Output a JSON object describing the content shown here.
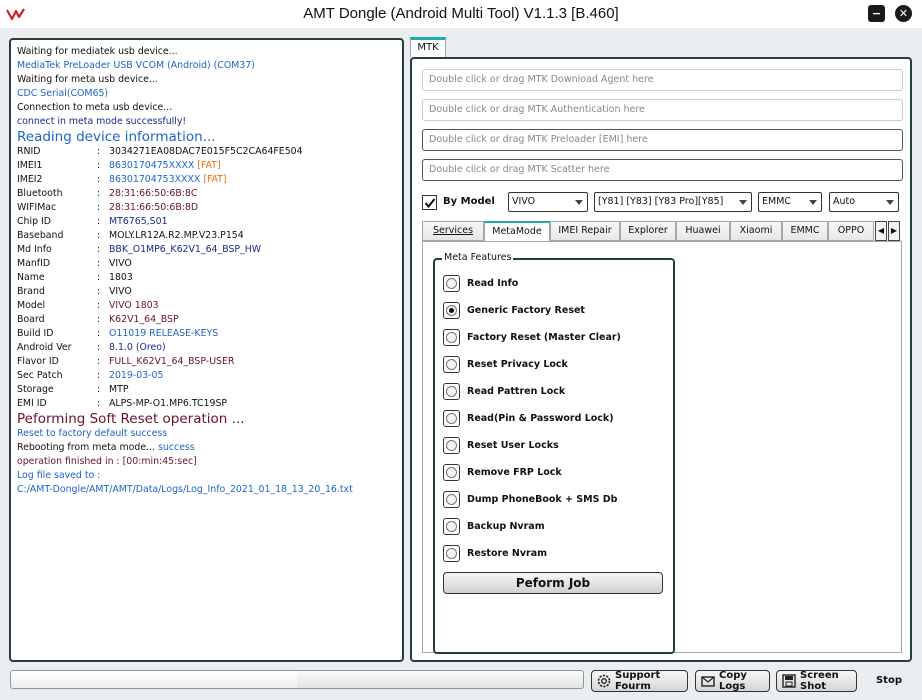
{
  "window": {
    "title": "AMT Dongle (Android Multi Tool) V1.1.3 [B.460]",
    "minimize_label": "−",
    "close_label": "✕"
  },
  "log": {
    "lines": [
      {
        "text": "Waiting for mediatek usb device...",
        "color": "black"
      },
      {
        "text": "MediaTek PreLoader USB VCOM (Android)  (COM37)",
        "color": "blue"
      },
      {
        "text": "Waiting for meta usb device...",
        "color": "black"
      },
      {
        "text": "CDC Serial(COM65)",
        "color": "blue"
      },
      {
        "text": "Connection to meta usb device...",
        "color": "black"
      },
      {
        "text": "connect in meta mode successfully!",
        "color": "navy"
      },
      {
        "text": "Reading device information...",
        "color": "blue"
      }
    ],
    "info": [
      {
        "key": "RNID",
        "sep": ":",
        "value": "3034271EA08DAC7E015F5C2CA64FE504",
        "value_color": "black"
      },
      {
        "key": "IMEI1",
        "sep": ":",
        "value": "8630170475XXXX",
        "value_color": "blue",
        "tag": "[FAT]"
      },
      {
        "key": "IMEI2",
        "sep": ":",
        "value": "86301704753XXXX",
        "value_color": "blue",
        "tag": "[FAT]"
      },
      {
        "key": "Bluetooth",
        "sep": ":",
        "value": "28:31:66:50:6B:8C",
        "value_color": "maroon"
      },
      {
        "key": "WIFIMac",
        "sep": ":",
        "value": "28:31:66:50:6B:8D",
        "value_color": "maroon"
      },
      {
        "key": "Chip ID",
        "sep": ":",
        "value": "MT6765,S01",
        "value_color": "navy"
      },
      {
        "key": "Baseband",
        "sep": ":",
        "value": "MOLY.LR12A.R2.MP.V23.P154",
        "value_color": "black"
      },
      {
        "key": "Md Info",
        "sep": ":",
        "value": "BBK_O1MP6_K62V1_64_BSP_HW",
        "value_color": "navy"
      },
      {
        "key": "ManfID",
        "sep": ":",
        "value": "VIVO",
        "value_color": "black"
      },
      {
        "key": "Name",
        "sep": ":",
        "value": "1803",
        "value_color": "black"
      },
      {
        "key": "Brand",
        "sep": ":",
        "value": "VIVO",
        "value_color": "black"
      },
      {
        "key": "Model",
        "sep": ":",
        "value": "VIVO 1803",
        "value_color": "maroon"
      },
      {
        "key": "Board",
        "sep": ":",
        "value": "K62V1_64_BSP",
        "value_color": "maroon"
      },
      {
        "key": "Build ID",
        "sep": ":",
        "value": "O11019 RELEASE-KEYS",
        "value_color": "blue"
      },
      {
        "key": "Android Ver",
        "sep": ":",
        "value": "8.1.0 (Oreo)",
        "value_color": "navy"
      },
      {
        "key": "Flavor ID",
        "sep": ":",
        "value": "FULL_K62V1_64_BSP-USER",
        "value_color": "maroon"
      },
      {
        "key": "Sec Patch",
        "sep": ":",
        "value": "2019-03-05",
        "value_color": "blue"
      },
      {
        "key": "Storage",
        "sep": ":",
        "value": "MTP",
        "value_color": "black"
      },
      {
        "key": "EMI ID",
        "sep": ":",
        "value": "ALPS-MP-O1.MP6.TC19SP",
        "value_color": "black"
      }
    ],
    "soft_reset_header": "Peforming Soft Reset operation ...",
    "reset_success": "Reset to factory default success",
    "rebooting_prefix": "Rebooting from meta mode...",
    "rebooting_status": "success",
    "operation_finished": "operation finished in : [00:min:45:sec]",
    "log_saved_label": "Log file saved to :",
    "log_path": "C:/AMT-Dongle/AMT/AMT/Data/Logs/Log_Info_2021_01_18_13_20_16.txt"
  },
  "colors": {
    "black": "#111111",
    "blue": "#1f64c8",
    "navy": "#1b2a8a",
    "maroon": "#6a1230",
    "orange": "#e0761c",
    "panel_border": "#25403a"
  },
  "progress": {
    "value": 0.5
  },
  "bottom_bar": {
    "support_label": "Support Fourm",
    "copy_logs_label": "Copy Logs",
    "screenshot_label": "Screen Shot",
    "stop_label": "Stop"
  },
  "mtk": {
    "tab_label": "MTK",
    "download_agent_placeholder": "Double click or drag MTK Download Agent here",
    "auth_placeholder": "Double click or drag MTK Authentication here",
    "preloader_placeholder": "Double click or drag MTK Preloader [EMI] here",
    "scatter_placeholder": "Double click or drag MTK Scatter here",
    "by_model_label": "By Model",
    "by_model_checked": true,
    "brand_select": "VIVO",
    "model_select": "[Y81] [Y83] [Y83 Pro][Y85]",
    "storage_select": "EMMC",
    "mode_select": "Auto",
    "tabs": [
      "Services",
      "MetaMode",
      "IMEI Repair",
      "Explorer",
      "Huawei",
      "Xiaomi",
      "EMMC",
      "OPPO"
    ],
    "active_tab": "MetaMode",
    "scroll_left": "◀",
    "scroll_right": "▶",
    "meta_features": {
      "legend": "Meta Features",
      "selected": "Generic Factory Reset",
      "options": [
        "Read Info",
        "Generic Factory Reset",
        "Factory Reset (Master Clear)",
        "Reset Privacy Lock",
        "Read Pattren Lock",
        "Read(Pin & Password Lock)",
        "Reset User Locks",
        "Remove FRP Lock",
        "Dump PhoneBook + SMS Db",
        "Backup Nvram",
        "Restore Nvram"
      ],
      "perform_label": "Peform Job"
    }
  }
}
